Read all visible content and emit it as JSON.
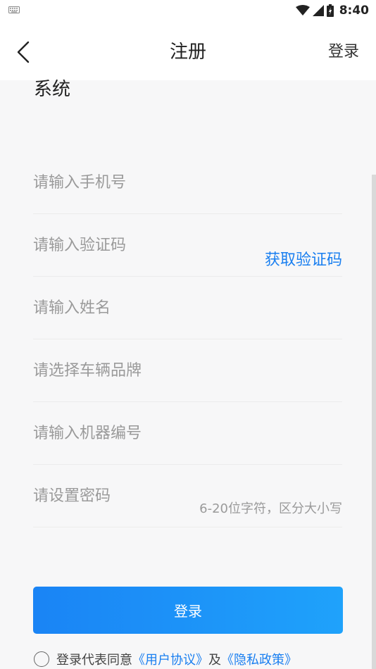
{
  "status_bar": {
    "time": "8:40",
    "icons": [
      "keyboard-icon",
      "wifi-icon",
      "signal-icon",
      "battery-icon"
    ]
  },
  "header": {
    "title": "注册",
    "login_label": "登录",
    "back_icon": "chevron-left-icon"
  },
  "partial_heading": "系统",
  "form": {
    "phone_placeholder": "请输入手机号",
    "code_placeholder": "请输入验证码",
    "get_code_label": "获取验证码",
    "name_placeholder": "请输入姓名",
    "brand_placeholder": "请选择车辆品牌",
    "machine_placeholder": "请输入机器编号",
    "password_placeholder": "请设置密码",
    "password_hint": "6-20位字符，区分大小写"
  },
  "submit_label": "登录",
  "agreement": {
    "prefix": "登录代表同意",
    "user_agreement": "《用户协议》",
    "conjunction": "及",
    "privacy_policy": "《隐私政策》"
  },
  "colors": {
    "accent": "#1a7ff0",
    "button_start": "#1a84f5",
    "button_end": "#1fa2fb",
    "background": "#f7f7f8"
  }
}
